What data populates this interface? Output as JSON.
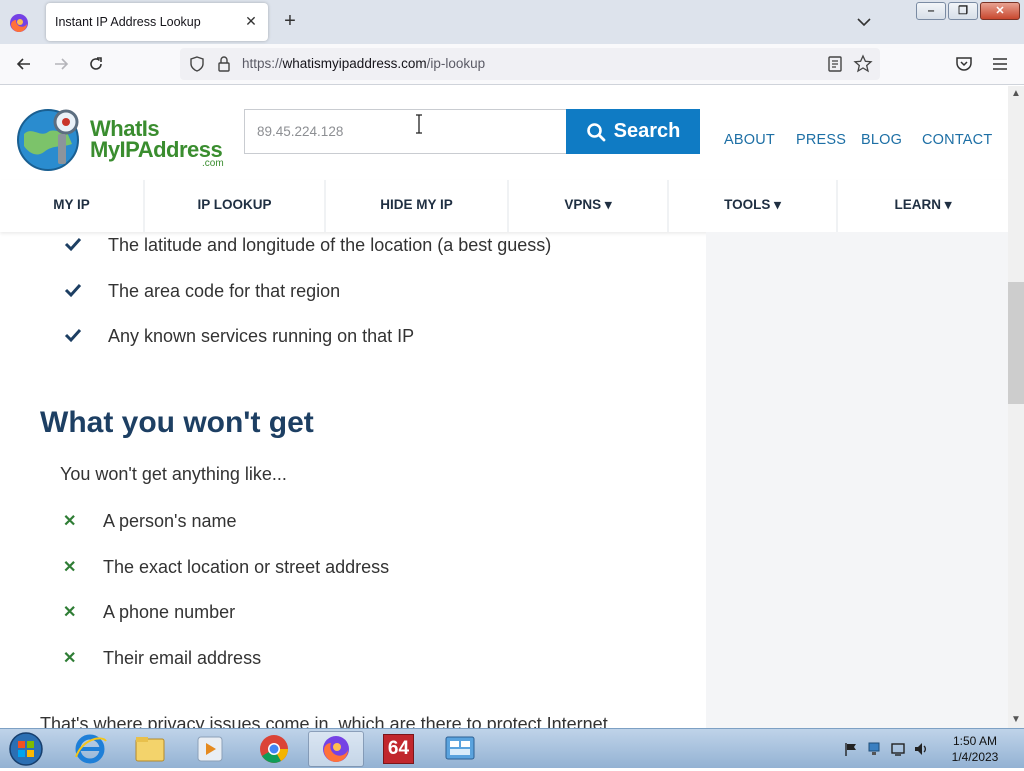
{
  "browser": {
    "tab_title": "Instant IP Address Lookup",
    "url_prefix": "https://",
    "url_host": "whatismyipaddress.com",
    "url_path": "/ip-lookup"
  },
  "site": {
    "logo_line1": "WhatIs",
    "logo_line2": "MyIPAddress",
    "logo_suffix": ".com",
    "search_placeholder": "89.45.224.128",
    "search_label": "Search",
    "top_links": [
      "ABOUT",
      "PRESS",
      "BLOG",
      "CONTACT"
    ],
    "main_nav": [
      "MY IP",
      "IP LOOKUP",
      "HIDE MY IP",
      "VPNS ▾",
      "TOOLS ▾",
      "LEARN ▾"
    ]
  },
  "content": {
    "get_items": [
      "The latitude and longitude of the location (a best guess)",
      "The area code for that region",
      "Any known services running on that IP"
    ],
    "heading": "What you won't get",
    "intro": "You won't get anything like...",
    "x_symbol": "✕",
    "wont_items": [
      "A person's name",
      "The exact location or street address",
      "A phone number",
      "Their email address"
    ],
    "trailing_text": "That's where privacy issues come in, which are there to protect Internet"
  },
  "taskbar": {
    "time": "1:50 AM",
    "date": "1/4/2023",
    "app_64_label": "64"
  },
  "colors": {
    "brand_green": "#3a8d2f",
    "brand_blue": "#0f7bc4",
    "heading_navy": "#1d3f63",
    "nav_link_blue": "#1d6fa5"
  }
}
